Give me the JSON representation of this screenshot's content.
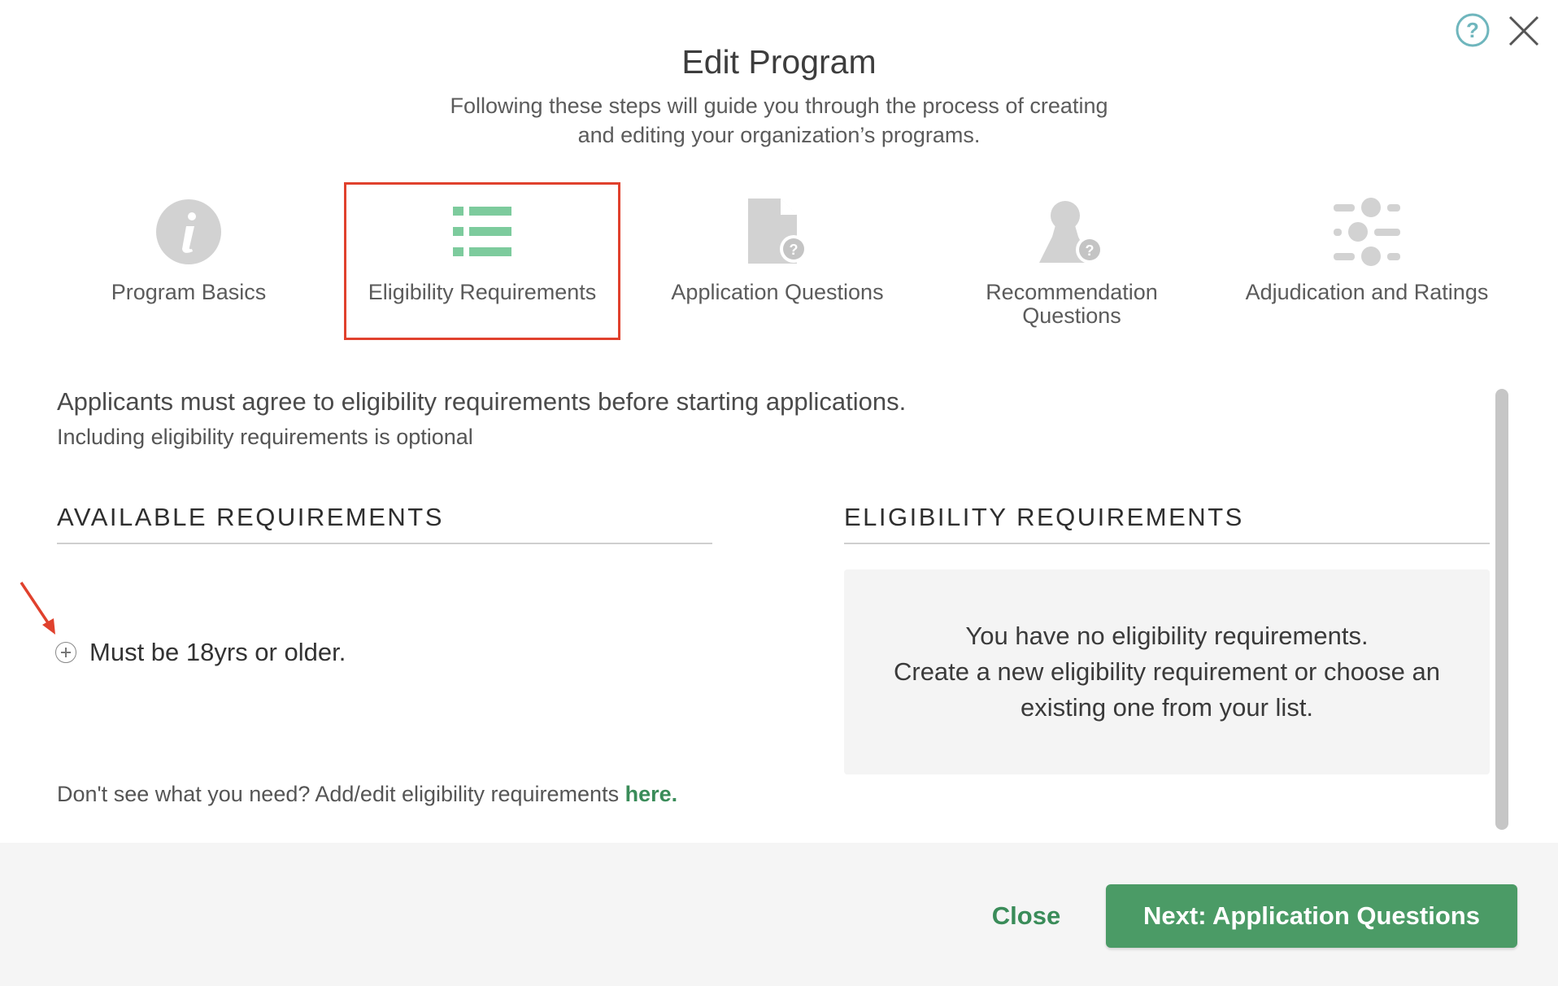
{
  "modal": {
    "title": "Edit Program",
    "subtitle_line1": "Following these steps will guide you through the process of creating",
    "subtitle_line2": "and editing your organization’s programs."
  },
  "steps": [
    {
      "label": "Program Basics",
      "icon": "info-icon",
      "active": false
    },
    {
      "label": "Eligibility Requirements",
      "icon": "list-icon",
      "active": true
    },
    {
      "label": "Application Questions",
      "icon": "document-question-icon",
      "active": false
    },
    {
      "label": "Recommendation Questions",
      "icon": "person-question-icon",
      "active": false
    },
    {
      "label": "Adjudication and Ratings",
      "icon": "sliders-icon",
      "active": false
    }
  ],
  "content": {
    "intro": "Applicants must agree to eligibility requirements before starting applications.",
    "intro_sub": "Including eligibility requirements is optional",
    "available_title": "AVAILABLE REQUIREMENTS",
    "eligibility_title": "ELIGIBILITY REQUIREMENTS",
    "available_items": [
      "Must be 18yrs or older."
    ],
    "empty_line1": "You have no eligibility requirements.",
    "empty_line2": "Create a new eligibility requirement or choose an existing one from your list.",
    "dont_see": "Don't see what you need? Add/edit eligibility requirements ",
    "dont_see_link": "here."
  },
  "footer": {
    "close_label": "Close",
    "next_label": "Next: Application Questions"
  },
  "colors": {
    "accent_green": "#4b9b66",
    "link_green": "#3a8c59",
    "active_icon_green": "#7dcb9d",
    "inactive_icon_gray": "#d2d2d2",
    "highlight_red": "#e0412d"
  }
}
